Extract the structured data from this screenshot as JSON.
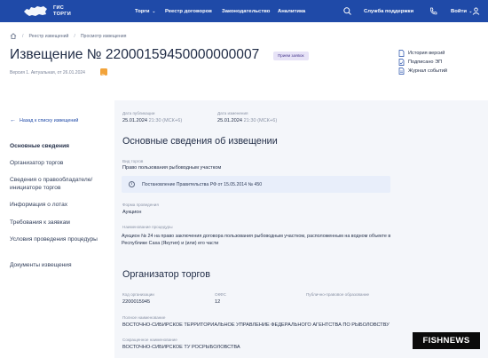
{
  "header": {
    "logo_line1": "ГИС",
    "logo_line2": "ТОРГИ",
    "nav": [
      "Торги",
      "Реестр договоров",
      "Законодательство",
      "Аналитика"
    ],
    "support": "Служба поддержки",
    "login": "Войти"
  },
  "breadcrumbs": [
    "Реестр извещений",
    "Просмотр извещения"
  ],
  "notice": {
    "title": "Извещение № 22000159450000000007",
    "badge": "Прием заявок",
    "version": "Версия 1. Актуальная, от 26.01.2024"
  },
  "side_links": [
    "История версий",
    "Подписано ЭП",
    "Журнал событий"
  ],
  "back_link": "Назад к списку извещений",
  "left_nav": [
    "Основные сведения",
    "Организатор торгов",
    "Сведения о правообладателе/ инициаторе торгов",
    "Информация о лотах",
    "Требования к заявкам",
    "Условия проведения процедуры",
    "Документы извещения"
  ],
  "publication": {
    "label": "Дата публикации",
    "date": "25.01.2024",
    "time": "21:30 (МСК+6)"
  },
  "modification": {
    "label": "Дата изменения",
    "date": "25.01.2024",
    "time": "21:30 (МСК+6)"
  },
  "basic": {
    "section_title": "Основные сведения об извещении",
    "auction_type_label": "Вид торгов",
    "auction_type": "Право пользования рыбоводным участком",
    "regulation": "Постановление Правительства РФ от 15.05.2014 № 450",
    "form_label": "Форма проведения",
    "form": "Аукцион",
    "name_label": "Наименование процедуры",
    "name": "Аукцион № 24 на право заключения договора пользования рыбоводным участком, расположенным на водном объекте в Республике Саха (Якутия) и (или) его части"
  },
  "organizer": {
    "section_title": "Организатор торгов",
    "code_label": "Код организации",
    "code": "2200015945",
    "okfs_label": "ОКФС",
    "okfs": "12",
    "legal_label": "Публично-правовое образование",
    "fullname_label": "Полное наименование",
    "fullname": "ВОСТОЧНО-СИБИРСКОЕ ТЕРРИТОРИАЛЬНОЕ УПРАВЛЕНИЕ ФЕДЕРАЛЬНОГО АГЕНТСТВА ПО РЫБОЛОВСТВУ",
    "shortname_label": "Сокращенное наименование",
    "shortname": "ВОСТОЧНО-СИБИРСКОЕ ТУ РОСРЫБОЛОВСТВА"
  },
  "watermark": {
    "fish": "FISH",
    "news": "NEWS"
  },
  "colors": {
    "header_bg": "#1f4aa8",
    "accent": "#1f4aa8",
    "badge_bg": "#e7e3f7"
  }
}
